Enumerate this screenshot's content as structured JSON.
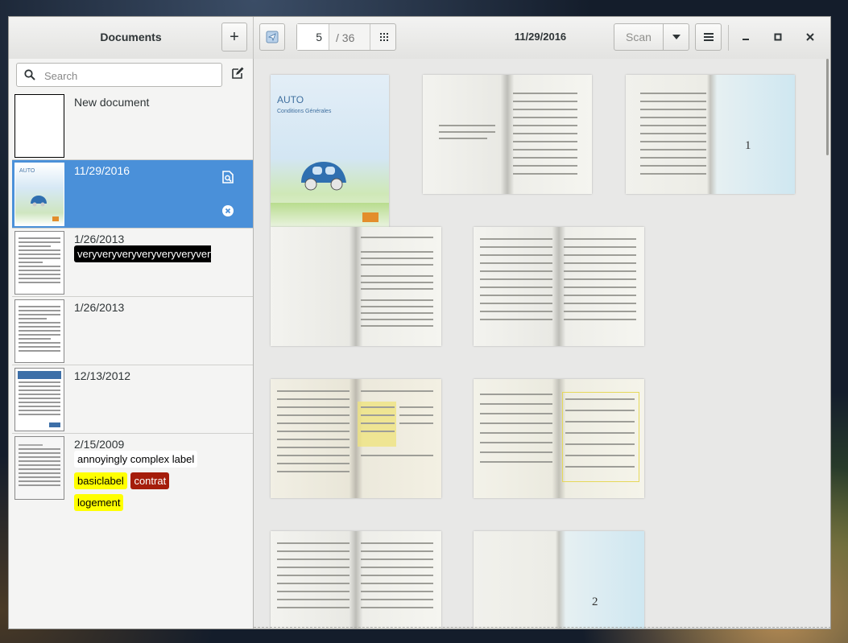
{
  "header": {
    "title": "Documents",
    "add_label": "+",
    "page_current": "5",
    "page_total": "/ 36",
    "doc_date": "11/29/2016",
    "scan_label": "Scan"
  },
  "sidebar": {
    "search_placeholder": "Search",
    "documents": [
      {
        "date": "New document",
        "labels": []
      },
      {
        "date": "11/29/2016",
        "labels": []
      },
      {
        "date": "1/26/2013",
        "labels": [
          {
            "text": "veryveryveryveryveryveryveryveryveryvery",
            "bg": "#000000",
            "fg": "#ffffff"
          }
        ]
      },
      {
        "date": "1/26/2013",
        "labels": []
      },
      {
        "date": "12/13/2012",
        "labels": []
      },
      {
        "date": "2/15/2009",
        "labels": [
          {
            "text": "annoyingly complex label",
            "bg": "#ffffff",
            "fg": "#000000"
          },
          {
            "text": "basiclabel",
            "bg": "#ffff00",
            "fg": "#000000"
          },
          {
            "text": "contrat",
            "bg": "#a51d0b",
            "fg": "#ffffff"
          },
          {
            "text": "logement",
            "bg": "#ffff00",
            "fg": "#000000"
          }
        ]
      }
    ]
  },
  "cover": {
    "title": "AUTO",
    "subtitle": "Conditions Générales"
  },
  "pages": {
    "page3_number": "1",
    "page10_number": "2"
  },
  "colors": {
    "selection": "#4a90d9",
    "label_black": "#000000",
    "label_yellow": "#ffff00",
    "label_red": "#a51d0b"
  }
}
